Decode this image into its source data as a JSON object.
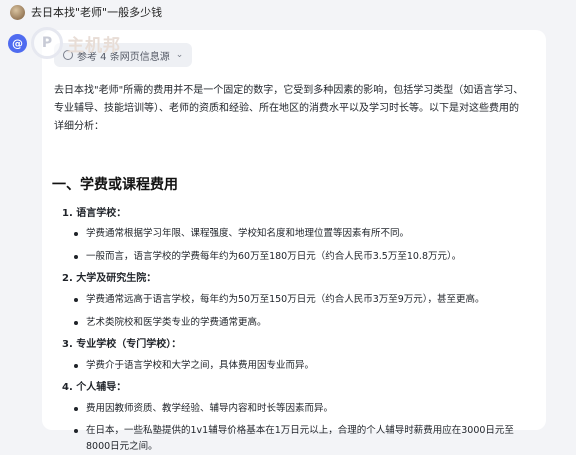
{
  "question": "去日本找\"老师\"一般多少钱",
  "watermark": {
    "icon": "@",
    "circle_letter": "P",
    "text": "主机邦"
  },
  "sources_chip": {
    "label": "参考 4 条网页信息源",
    "icon": "globe-icon",
    "chevron": "⌄"
  },
  "intro": "去日本找\"老师\"所需的费用并不是一个固定的数字，它受到多种因素的影响，包括学习类型（如语言学习、专业辅导、技能培训等）、老师的资质和经验、所在地区的消费水平以及学习时长等。以下是对这些费用的详细分析：",
  "section_title": "一、学费或课程费用",
  "items": [
    {
      "num": "1.",
      "title": "语言学校：",
      "bullets": [
        "学费通常根据学习年限、课程强度、学校知名度和地理位置等因素有所不同。",
        "一般而言，语言学校的学费每年约为60万至180万日元（约合人民币3.5万至10.8万元）。"
      ]
    },
    {
      "num": "2.",
      "title": "大学及研究生院：",
      "bullets": [
        "学费通常远高于语言学校，每年约为50万至150万日元（约合人民币3万至9万元），甚至更高。",
        "艺术类院校和医学类专业的学费通常更高。"
      ]
    },
    {
      "num": "3.",
      "title": "专业学校（专门学校）：",
      "bullets": [
        "学费介于语言学校和大学之间，具体费用因专业而异。"
      ]
    },
    {
      "num": "4.",
      "title": "个人辅导：",
      "bullets": [
        "费用因教师资质、教学经验、辅导内容和时长等因素而异。",
        "在日本，一些私塾提供的1v1辅导价格基本在1万日元以上，合理的个人辅导时薪费用应在3000日元至8000日元之间。"
      ]
    }
  ]
}
